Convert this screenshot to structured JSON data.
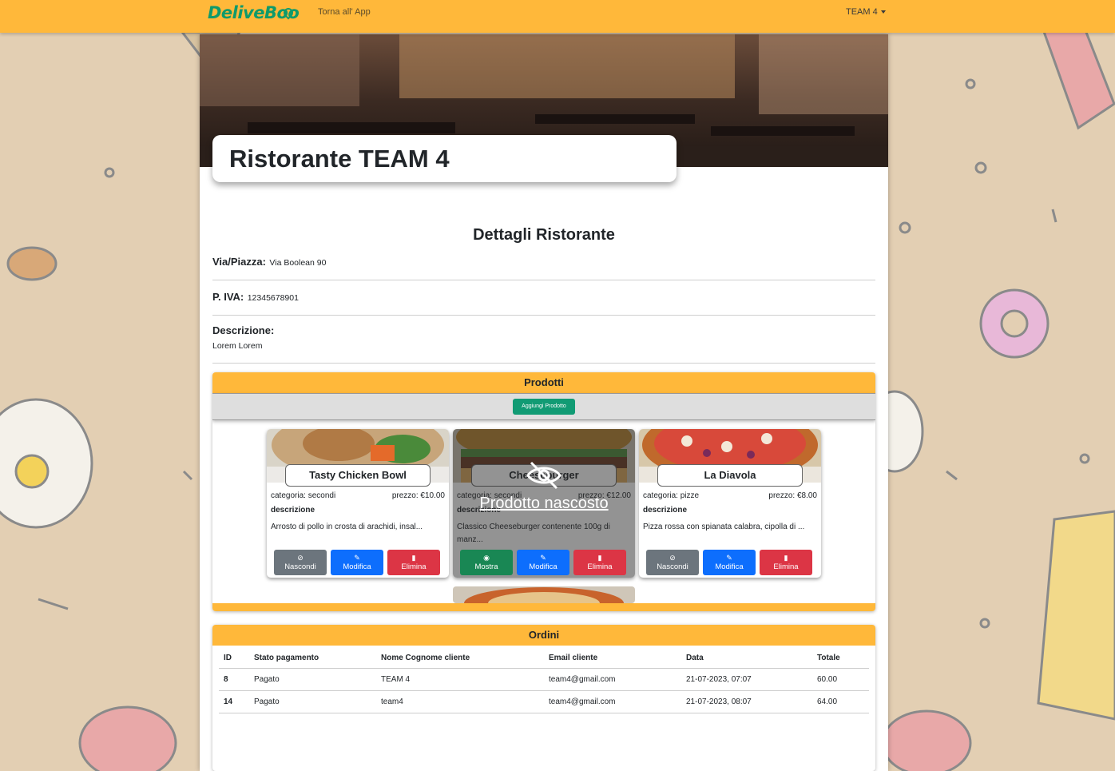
{
  "navbar": {
    "logo": "DeliveBoo",
    "back_link": "Torna all' App",
    "user_menu": "TEAM 4"
  },
  "restaurant": {
    "name": "Ristorante TEAM 4"
  },
  "details": {
    "title": "Dettagli Ristorante",
    "address_label": "Via/Piazza:",
    "address_value": "Via Boolean 90",
    "vat_label": "P. IVA:",
    "vat_value": "12345678901",
    "description_label": "Descrizione:",
    "description_value": "Lorem Lorem"
  },
  "products": {
    "title": "Prodotti",
    "add_label": "Aggiungi Prodotto",
    "items": [
      {
        "name": "Tasty Chicken Bowl",
        "category": "categoria: secondi",
        "price": "prezzo: €10.00",
        "desc_label": "descrizione",
        "description": "Arrosto di pollo in crosta di arachidi, insal...",
        "toggle_label": "Nascondi",
        "edit_label": "Modifica",
        "delete_label": "Elimina"
      },
      {
        "name": "Cheeseburger",
        "category": "categoria: secondi",
        "price": "prezzo: €12.00",
        "desc_label": "descrizione",
        "description": "Classico Cheeseburger contenente 100g di manz...",
        "toggle_label": "Mostra",
        "edit_label": "Modifica",
        "delete_label": "Elimina",
        "hidden_label": "Prodotto nascosto"
      },
      {
        "name": "La Diavola",
        "category": "categoria: pizze",
        "price": "prezzo: €8.00",
        "desc_label": "descrizione",
        "description": "Pizza rossa con spianata calabra, cipolla di ...",
        "toggle_label": "Nascondi",
        "edit_label": "Modifica",
        "delete_label": "Elimina"
      }
    ]
  },
  "orders": {
    "title": "Ordini",
    "headers": [
      "ID",
      "Stato pagamento",
      "Nome Cognome cliente",
      "Email cliente",
      "Data",
      "Totale"
    ],
    "rows": [
      [
        "8",
        "Pagato",
        "TEAM 4",
        "team4@gmail.com",
        "21-07-2023, 07:07",
        "60.00"
      ],
      [
        "14",
        "Pagato",
        "team4",
        "team4@gmail.com",
        "21-07-2023, 08:07",
        "64.00"
      ]
    ]
  },
  "colors": {
    "accent": "#ffb83a",
    "brand_green": "#0f9a6b",
    "hide_button": "#6c757d",
    "edit_button": "#0d6efd",
    "delete_button": "#dc3545",
    "show_button": "#198754"
  },
  "icons": {
    "hide": "eye-slash-icon",
    "show": "eye-icon",
    "edit": "pencil-square-icon",
    "delete": "trash-icon"
  }
}
